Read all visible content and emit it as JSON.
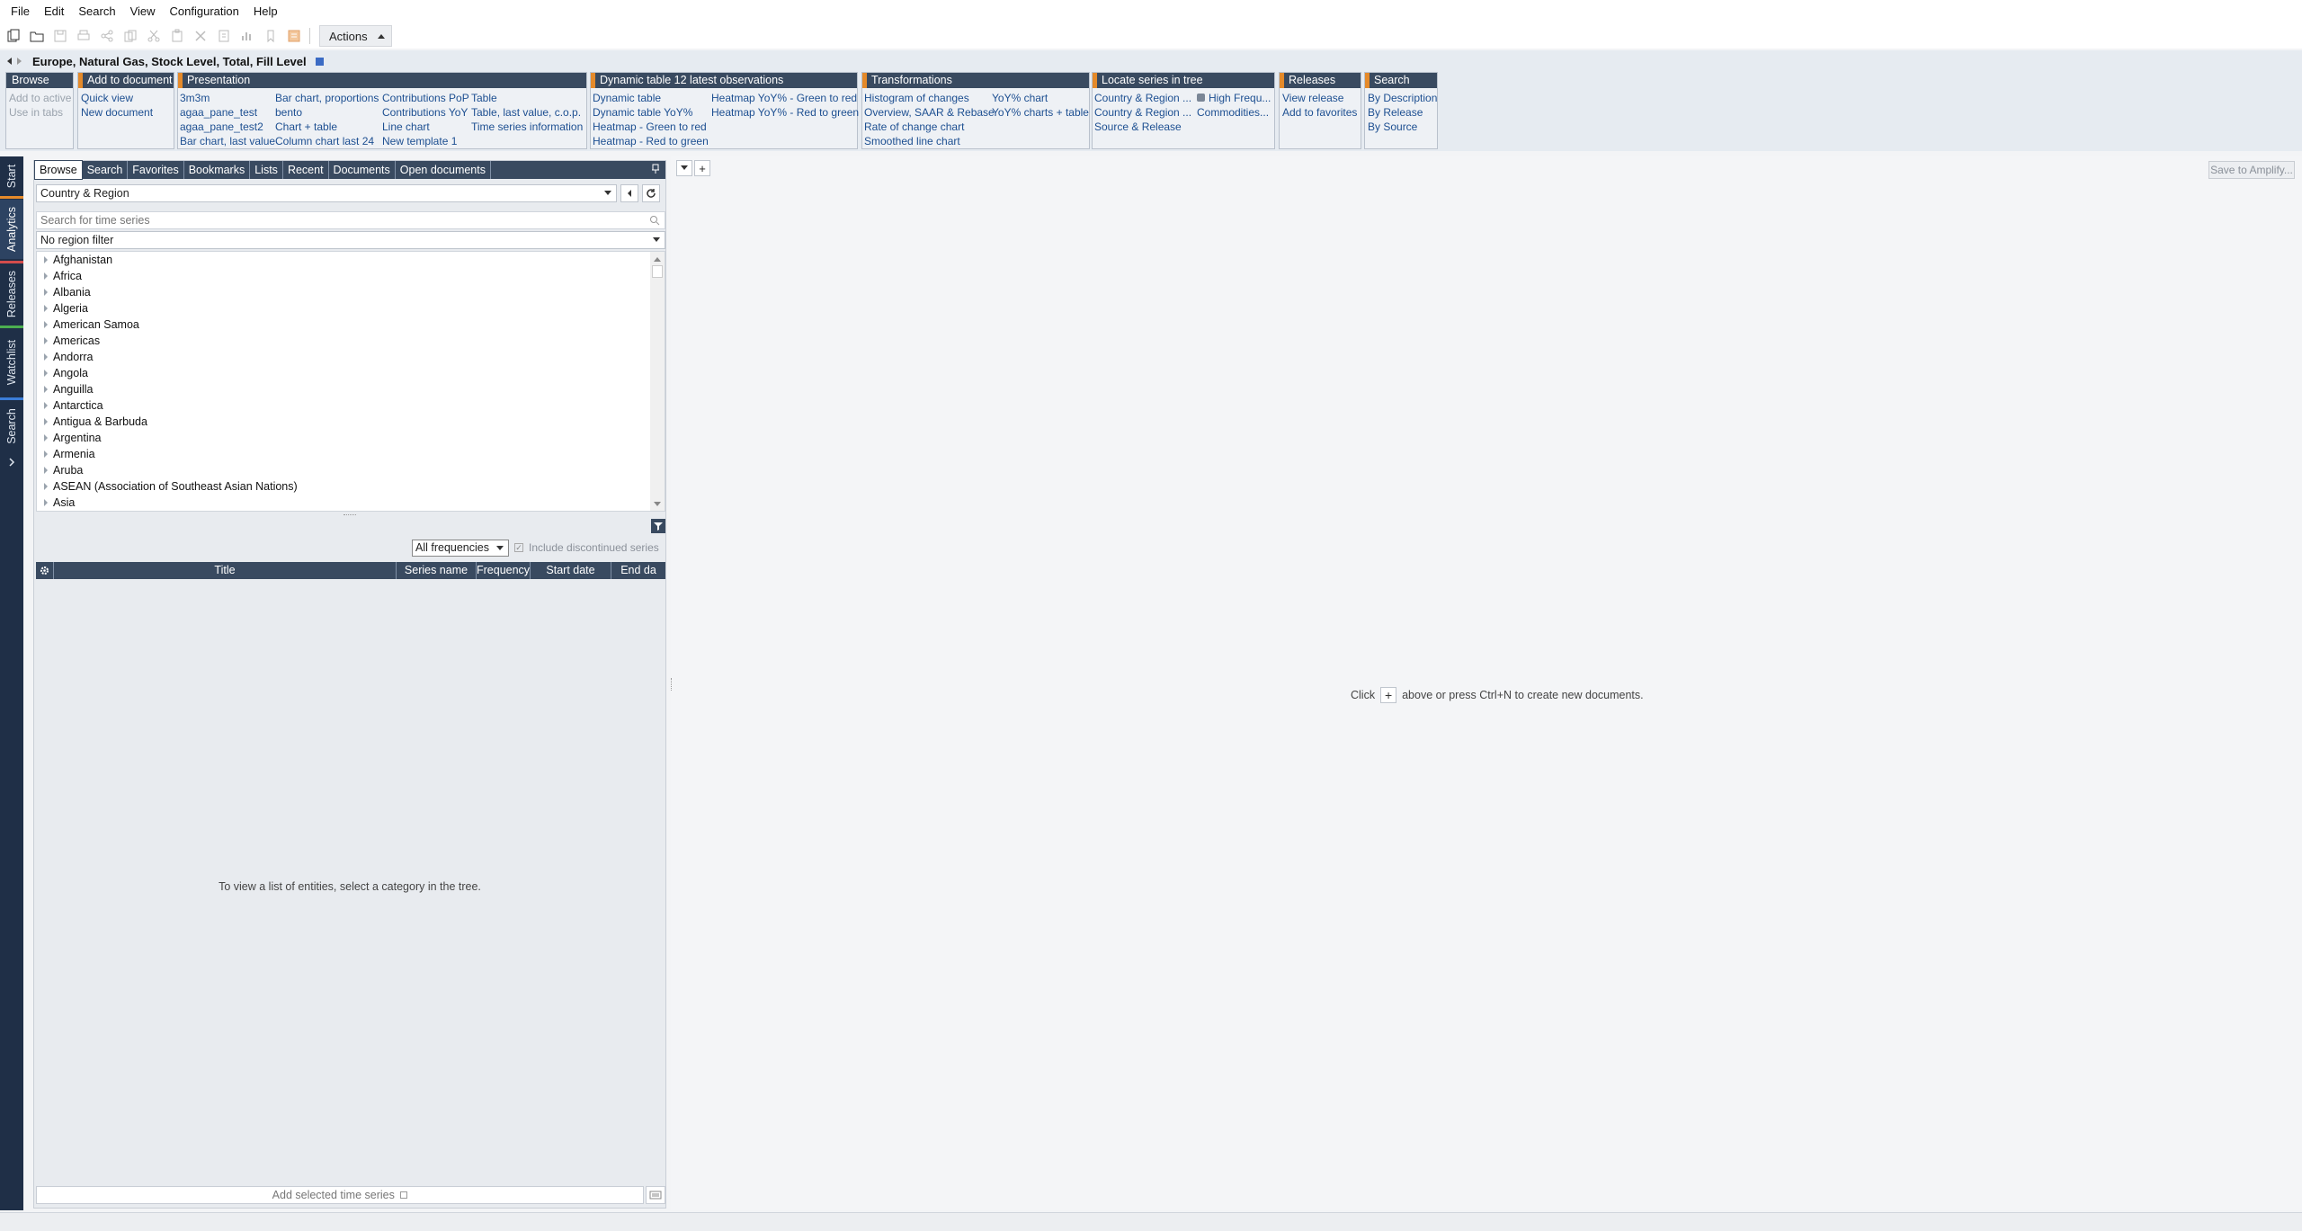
{
  "menu": [
    "File",
    "Edit",
    "Search",
    "View",
    "Configuration",
    "Help"
  ],
  "toolbar": {
    "actions_label": "Actions"
  },
  "doc_title": "Europe, Natural Gas, Stock Level, Total, Fill Level",
  "ribbon": {
    "browse": {
      "title": "Browse",
      "items": [
        "Add to active",
        "Use in tabs"
      ]
    },
    "add_to_document": {
      "title": "Add to document",
      "items": [
        "Quick view",
        "New document"
      ]
    },
    "presentation": {
      "title": "Presentation",
      "col1": [
        "3m3m",
        "agaa_pane_test",
        "agaa_pane_test2",
        "Bar chart, last value"
      ],
      "col2": [
        "Bar chart, proportions",
        "bento",
        "Chart + table",
        "Column chart last 24"
      ],
      "col3": [
        "Contributions PoP",
        "Contributions YoY",
        "Line chart",
        "New template 1"
      ],
      "col4": [
        "Table",
        "Table, last value, c.o.p.",
        "Time series information"
      ]
    },
    "dynamic_table": {
      "title": "Dynamic table 12 latest observations",
      "col1": [
        "Dynamic table",
        "Dynamic table YoY%",
        "Heatmap - Green to red",
        "Heatmap - Red to green"
      ],
      "col2": [
        "Heatmap YoY% - Green to red",
        "Heatmap YoY% - Red to green"
      ]
    },
    "transformations": {
      "title": "Transformations",
      "col1": [
        "Histogram of changes",
        "Overview, SAAR & Rebase",
        "Rate of change chart",
        "Smoothed line chart"
      ],
      "col2": [
        "YoY% chart",
        "YoY% charts + table"
      ]
    },
    "locate": {
      "title": "Locate series in tree",
      "col1": [
        "Country & Region ...",
        "Country & Region ...",
        "Source & Release"
      ],
      "col2": [
        "High Frequ...",
        "Commodities..."
      ]
    },
    "releases": {
      "title": "Releases",
      "items": [
        "View release",
        "Add to favorites"
      ]
    },
    "search": {
      "title": "Search",
      "items": [
        "By Description",
        "By Release",
        "By Source"
      ]
    }
  },
  "sidebar": {
    "tabs": [
      "Start",
      "Analytics",
      "Releases",
      "Watchlist",
      "Search"
    ]
  },
  "panel": {
    "tabs": [
      "Browse",
      "Search",
      "Favorites",
      "Bookmarks",
      "Lists",
      "Recent",
      "Documents",
      "Open documents"
    ],
    "category": "Country & Region",
    "search_placeholder": "Search for time series",
    "region_filter": "No region filter",
    "tree": [
      "Afghanistan",
      "Africa",
      "Albania",
      "Algeria",
      "American Samoa",
      "Americas",
      "Andorra",
      "Angola",
      "Anguilla",
      "Antarctica",
      "Antigua & Barbuda",
      "Argentina",
      "Armenia",
      "Aruba",
      "ASEAN (Association of Southeast Asian Nations)",
      "Asia"
    ],
    "frequency": "All frequencies",
    "include_discontinued": "Include discontinued series",
    "columns": [
      "Title",
      "Series name",
      "Frequency",
      "Start date",
      "End da"
    ],
    "empty_message": "To view a list of entities, select a category in the tree.",
    "add_selected": "Add selected time series"
  },
  "doc_area": {
    "save_button": "Save to Amplify...",
    "hint_before": "Click",
    "hint_after": "above or press Ctrl+N to create new documents."
  },
  "colors": {
    "header_navy": "#394a60",
    "accent_orange": "#e58a2a",
    "link_blue": "#1d4f91",
    "sidebar": "#1f2f47"
  }
}
